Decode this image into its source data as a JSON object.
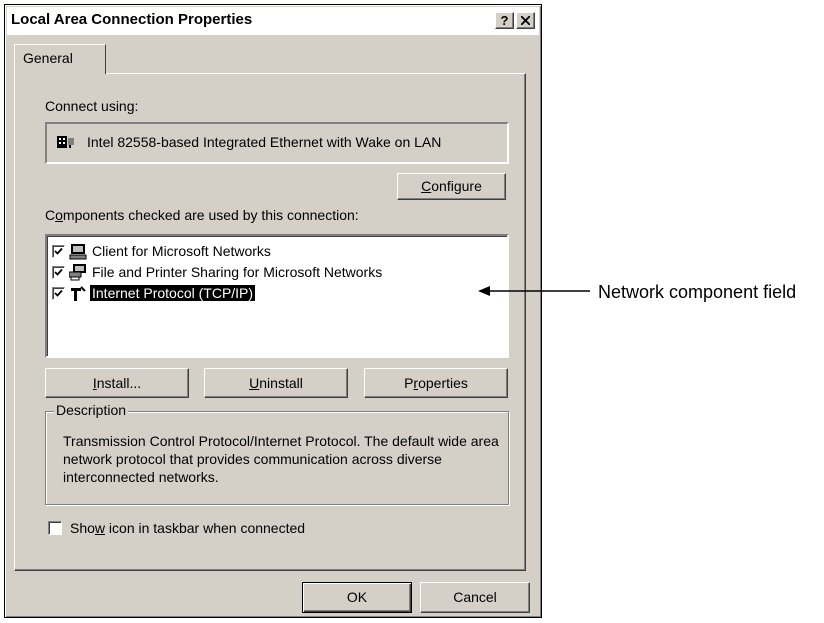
{
  "window": {
    "title": "Local Area Connection Properties",
    "help_label": "?",
    "close_label": "✕"
  },
  "tabs": [
    {
      "label": "General",
      "active": true
    }
  ],
  "connect_using": {
    "label": "Connect using:",
    "adapter": "Intel 82558-based Integrated Ethernet with Wake on LAN",
    "adapter_icon": "network-adapter-icon"
  },
  "configure_button": {
    "label_before": "",
    "label_accel": "C",
    "label_after": "onfigure"
  },
  "components": {
    "label_before": "C",
    "label_accel": "o",
    "label_after": "mponents checked are used by this connection:",
    "items": [
      {
        "label": "Client for Microsoft Networks",
        "checked": true,
        "icon": "network-client-icon",
        "selected": false
      },
      {
        "label": "File and Printer Sharing for Microsoft Networks",
        "checked": true,
        "icon": "file-printer-sharing-icon",
        "selected": false
      },
      {
        "label": "Internet Protocol (TCP/IP)",
        "checked": true,
        "icon": "protocol-icon",
        "selected": true
      }
    ]
  },
  "buttons": {
    "install": {
      "before": "",
      "accel": "I",
      "after": "nstall..."
    },
    "uninstall": {
      "before": "",
      "accel": "U",
      "after": "ninstall"
    },
    "properties": {
      "before": "P",
      "accel": "r",
      "after": "operties"
    },
    "ok": "OK",
    "cancel": "Cancel"
  },
  "description": {
    "title": "Description",
    "text": "Transmission Control Protocol/Internet Protocol. The default wide area network protocol that provides communication across diverse interconnected networks."
  },
  "show_icon": {
    "before": "Sho",
    "accel": "w",
    "after": " icon in taskbar when connected",
    "checked": false
  },
  "annotation": {
    "label": "Network component field"
  },
  "colors": {
    "dialog_face": "#d4d0c8",
    "selection": "#000000"
  }
}
